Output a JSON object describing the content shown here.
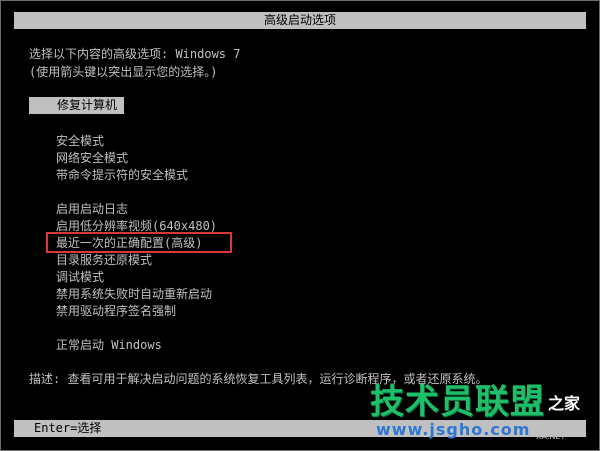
{
  "colors": {
    "background": "#000000",
    "text": "#c0c0c0",
    "bar_background": "#c0c0c0",
    "bar_text": "#000000",
    "highlight_border": "#d9383a",
    "watermark_green": "#1fbf6a",
    "watermark_blue": "#2d78d4"
  },
  "header": {
    "title": "高级启动选项"
  },
  "prompt": {
    "line1": "选择以下内容的高级选项: Windows 7",
    "line2": "(使用箭头键以突出显示您的选择。)"
  },
  "menu": {
    "selected_item": "修复计算机",
    "group1": [
      "安全模式",
      "网络安全模式",
      "带命令提示符的安全模式"
    ],
    "group2": [
      "启用启动日志",
      "启用低分辨率视频(640x480)",
      "最近一次的正确配置(高级)",
      "目录服务还原模式",
      "调试模式",
      "禁用系统失败时自动重新启动",
      "禁用驱动程序签名强制"
    ],
    "group3": [
      "正常启动 Windows"
    ]
  },
  "description": {
    "text": "描述: 查看可用于解决启动问题的系统恢复工具列表，运行诊断程序，或者还原系统。"
  },
  "footer": {
    "text": "Enter=选择"
  },
  "watermark": {
    "logo": "技术员联盟",
    "suffix": "之家",
    "url": "www.jsgho.com",
    "net": "XA.NET"
  }
}
